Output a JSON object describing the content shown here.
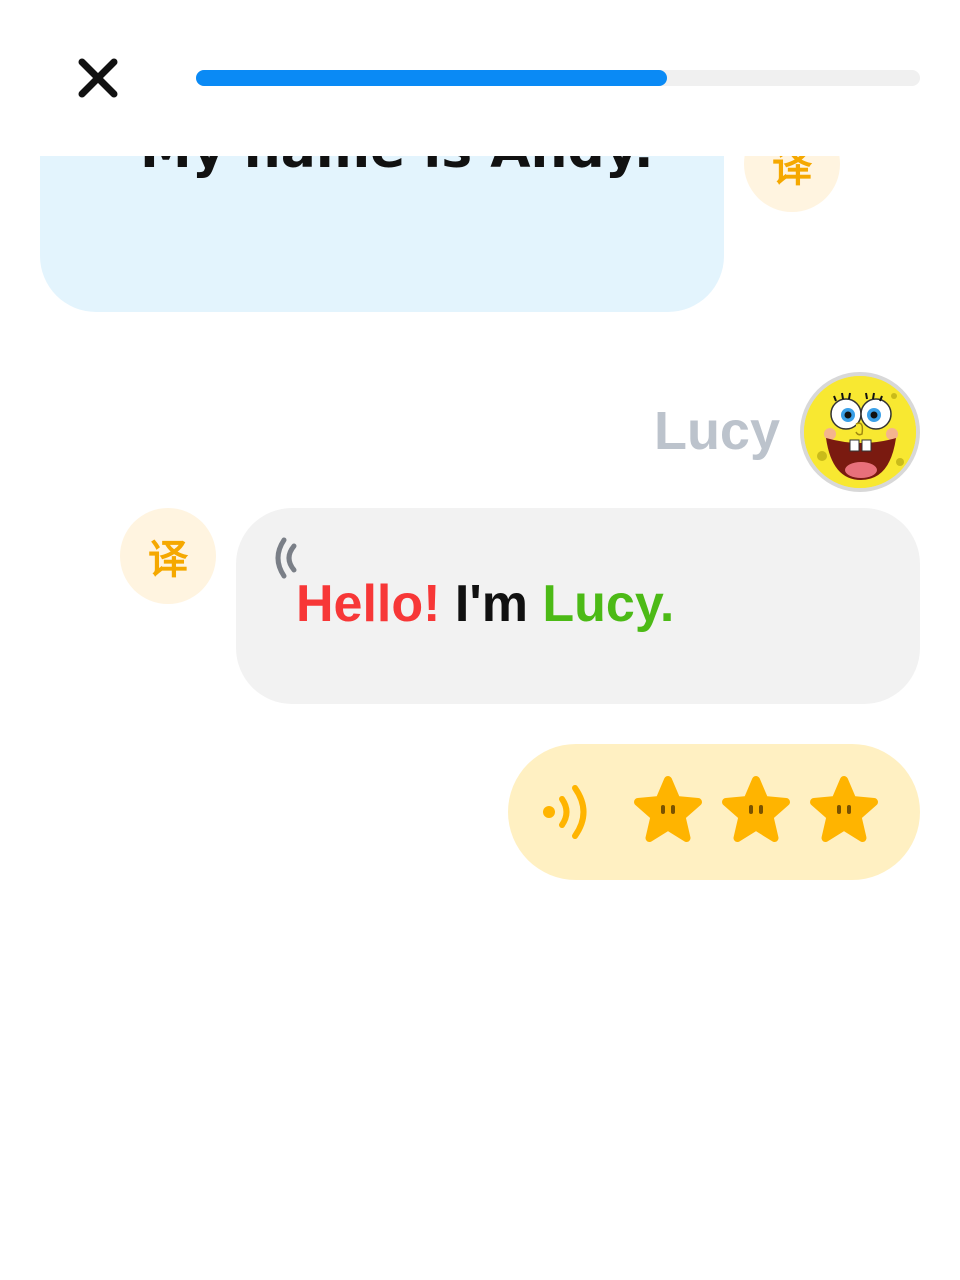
{
  "header": {
    "close_icon": "close-icon",
    "progress": 0.65
  },
  "messages": {
    "andy": {
      "text": "My name is Andy.",
      "sound_icon": "sound-wave-icon",
      "translate_label": "译"
    },
    "lucy": {
      "name": "Lucy",
      "avatar": "spongebob-avatar",
      "words": [
        {
          "text": "Hello!",
          "color": "#f73737"
        },
        {
          "text": " I'm ",
          "color": "#111111"
        },
        {
          "text": "Lucy.",
          "color": "#4cba16"
        }
      ],
      "sound_icon": "sound-wave-icon",
      "translate_label": "译"
    }
  },
  "score": {
    "sound_icon": "sound-wave-icon",
    "stars": 3,
    "stars_total": 3,
    "star_color": "#ffb400"
  },
  "colors": {
    "accent_blue": "#0a8af5",
    "andy_bubble": "#e3f4fd",
    "lucy_bubble": "#f2f2f2",
    "score_bg": "#fff0c2",
    "translate_color": "#f5a800"
  }
}
